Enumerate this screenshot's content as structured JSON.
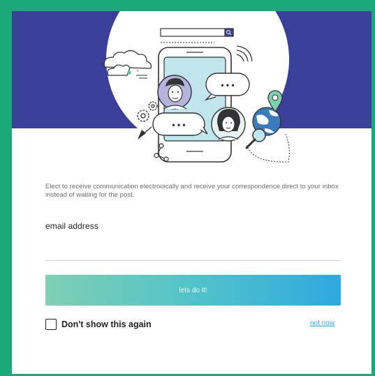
{
  "dialog": {
    "description": "Elect to receive communication electronically and receive your correspondence direct to your inbox instead of waiting for the post.",
    "email_label": "email address",
    "email_value": "",
    "email_placeholder": "",
    "cta_label": "lets do it!",
    "dont_show_label": "Don't show this again",
    "not_now_label": "not now"
  },
  "illustration": {
    "icons": [
      "search-bar-icon",
      "cloud-icon",
      "phone-icon",
      "chat-bubble-icon",
      "avatar-man-icon",
      "avatar-woman-icon",
      "gear-icon",
      "cursor-arrow-icon",
      "wifi-signal-icon",
      "location-pin-icon",
      "globe-icon",
      "magnifier-icon",
      "share-node-icon"
    ],
    "chat_text": "• • •"
  },
  "colors": {
    "frame": "#1aa878",
    "hero_background": "#3a3f9a",
    "cta_gradient_start": "#7fd0b2",
    "cta_gradient_end": "#2ea9e1",
    "link": "#2ea9e1",
    "phone_screen": "#bfe6ec",
    "avatar_bg": "#b6b4dc"
  }
}
